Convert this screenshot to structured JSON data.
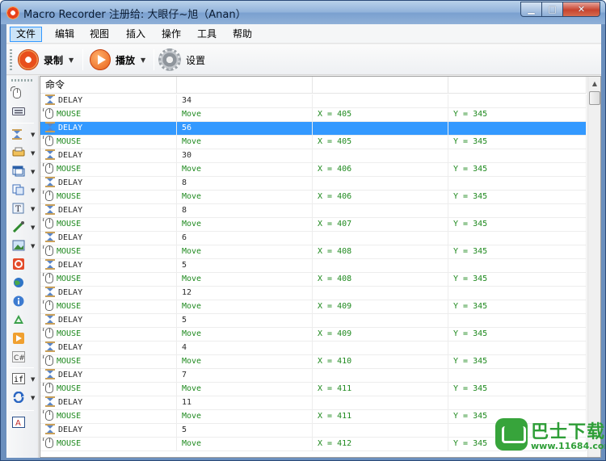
{
  "window": {
    "title": "Macro Recorder 注册给: 大眼仔~旭（Anan）",
    "min_glyph": "▁",
    "max_glyph": "□",
    "close_glyph": "✕"
  },
  "menu": {
    "items": [
      "文件",
      "编辑",
      "视图",
      "插入",
      "操作",
      "工具",
      "帮助"
    ]
  },
  "toolbar": {
    "record_label": "录制",
    "play_label": "播放",
    "settings_label": "设置",
    "dropdown_glyph": "▼"
  },
  "sidebar": {
    "dropdown_glyph": "▼"
  },
  "table": {
    "header": [
      "命令",
      "",
      "",
      ""
    ],
    "rows": [
      {
        "type": "delay",
        "cmd": "DELAY",
        "a": "34",
        "b": "",
        "c": ""
      },
      {
        "type": "mouse",
        "cmd": "MOUSE",
        "a": "Move",
        "b": "X = 405",
        "c": "Y = 345"
      },
      {
        "type": "delay",
        "cmd": "DELAY",
        "a": "56",
        "b": "",
        "c": "",
        "selected": true
      },
      {
        "type": "mouse",
        "cmd": "MOUSE",
        "a": "Move",
        "b": "X = 405",
        "c": "Y = 345"
      },
      {
        "type": "delay",
        "cmd": "DELAY",
        "a": "30",
        "b": "",
        "c": ""
      },
      {
        "type": "mouse",
        "cmd": "MOUSE",
        "a": "Move",
        "b": "X = 406",
        "c": "Y = 345"
      },
      {
        "type": "delay",
        "cmd": "DELAY",
        "a": "8",
        "b": "",
        "c": ""
      },
      {
        "type": "mouse",
        "cmd": "MOUSE",
        "a": "Move",
        "b": "X = 406",
        "c": "Y = 345"
      },
      {
        "type": "delay",
        "cmd": "DELAY",
        "a": "8",
        "b": "",
        "c": ""
      },
      {
        "type": "mouse",
        "cmd": "MOUSE",
        "a": "Move",
        "b": "X = 407",
        "c": "Y = 345"
      },
      {
        "type": "delay",
        "cmd": "DELAY",
        "a": "6",
        "b": "",
        "c": ""
      },
      {
        "type": "mouse",
        "cmd": "MOUSE",
        "a": "Move",
        "b": "X = 408",
        "c": "Y = 345"
      },
      {
        "type": "delay",
        "cmd": "DELAY",
        "a": "5",
        "b": "",
        "c": ""
      },
      {
        "type": "mouse",
        "cmd": "MOUSE",
        "a": "Move",
        "b": "X = 408",
        "c": "Y = 345"
      },
      {
        "type": "delay",
        "cmd": "DELAY",
        "a": "12",
        "b": "",
        "c": ""
      },
      {
        "type": "mouse",
        "cmd": "MOUSE",
        "a": "Move",
        "b": "X = 409",
        "c": "Y = 345"
      },
      {
        "type": "delay",
        "cmd": "DELAY",
        "a": "5",
        "b": "",
        "c": ""
      },
      {
        "type": "mouse",
        "cmd": "MOUSE",
        "a": "Move",
        "b": "X = 409",
        "c": "Y = 345"
      },
      {
        "type": "delay",
        "cmd": "DELAY",
        "a": "4",
        "b": "",
        "c": ""
      },
      {
        "type": "mouse",
        "cmd": "MOUSE",
        "a": "Move",
        "b": "X = 410",
        "c": "Y = 345"
      },
      {
        "type": "delay",
        "cmd": "DELAY",
        "a": "7",
        "b": "",
        "c": ""
      },
      {
        "type": "mouse",
        "cmd": "MOUSE",
        "a": "Move",
        "b": "X = 411",
        "c": "Y = 345"
      },
      {
        "type": "delay",
        "cmd": "DELAY",
        "a": "11",
        "b": "",
        "c": ""
      },
      {
        "type": "mouse",
        "cmd": "MOUSE",
        "a": "Move",
        "b": "X = 411",
        "c": "Y = 345"
      },
      {
        "type": "delay",
        "cmd": "DELAY",
        "a": "5",
        "b": "",
        "c": ""
      },
      {
        "type": "mouse",
        "cmd": "MOUSE",
        "a": "Move",
        "b": "X = 412",
        "c": "Y = 345"
      }
    ]
  },
  "scrollbar": {
    "up_glyph": "▲"
  },
  "watermark": {
    "text": "巴士下载",
    "url": "www.11684.com"
  }
}
